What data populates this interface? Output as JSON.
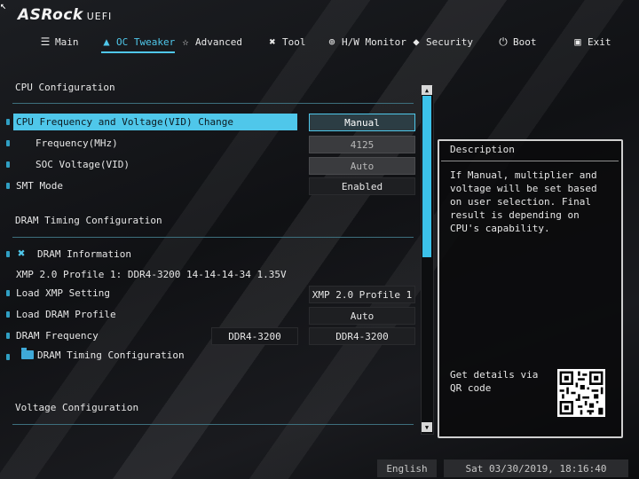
{
  "brand": {
    "name": "ASRock",
    "suffix": "UEFI"
  },
  "nav": [
    {
      "label": "Main",
      "icon": "list-icon"
    },
    {
      "label": "OC Tweaker",
      "icon": "flame-icon",
      "active": true
    },
    {
      "label": "Advanced",
      "icon": "star-icon"
    },
    {
      "label": "Tool",
      "icon": "tools-icon"
    },
    {
      "label": "H/W Monitor",
      "icon": "monitor-icon"
    },
    {
      "label": "Security",
      "icon": "shield-icon"
    },
    {
      "label": "Boot",
      "icon": "power-icon"
    },
    {
      "label": "Exit",
      "icon": "exit-icon"
    }
  ],
  "sections": {
    "cpu": "CPU Configuration",
    "dram": "DRAM Timing Configuration",
    "voltage": "Voltage Configuration"
  },
  "rows": {
    "cpu_freq_voltage": {
      "label": "CPU Frequency and Voltage(VID) Change",
      "value": "Manual"
    },
    "frequency": {
      "label": "Frequency(MHz)",
      "value": "4125"
    },
    "soc_voltage": {
      "label": "SOC Voltage(VID)",
      "value": "Auto"
    },
    "smt_mode": {
      "label": "SMT Mode",
      "value": "Enabled"
    },
    "dram_info": {
      "label": "DRAM Information"
    },
    "xmp_profile": {
      "label": "XMP 2.0 Profile 1: DDR4-3200 14-14-14-34 1.35V"
    },
    "load_xmp": {
      "label": "Load XMP Setting",
      "value": "XMP 2.0 Profile 1"
    },
    "load_dram_profile": {
      "label": "Load DRAM Profile",
      "value": "Auto"
    },
    "dram_frequency": {
      "label": "DRAM Frequency",
      "current": "DDR4-3200",
      "value": "DDR4-3200"
    },
    "dram_timing": {
      "label": "DRAM Timing Configuration"
    }
  },
  "description": {
    "title": "Description",
    "text": "If Manual, multiplier and voltage will be set based on user selection. Final result is depending on CPU's capability.",
    "qr_label": "Get details via QR code"
  },
  "footer": {
    "language": "English",
    "datetime": "Sat 03/30/2019, 18:16:40"
  },
  "colors": {
    "accent": "#4fc7ea",
    "background": "#0d0e10"
  }
}
